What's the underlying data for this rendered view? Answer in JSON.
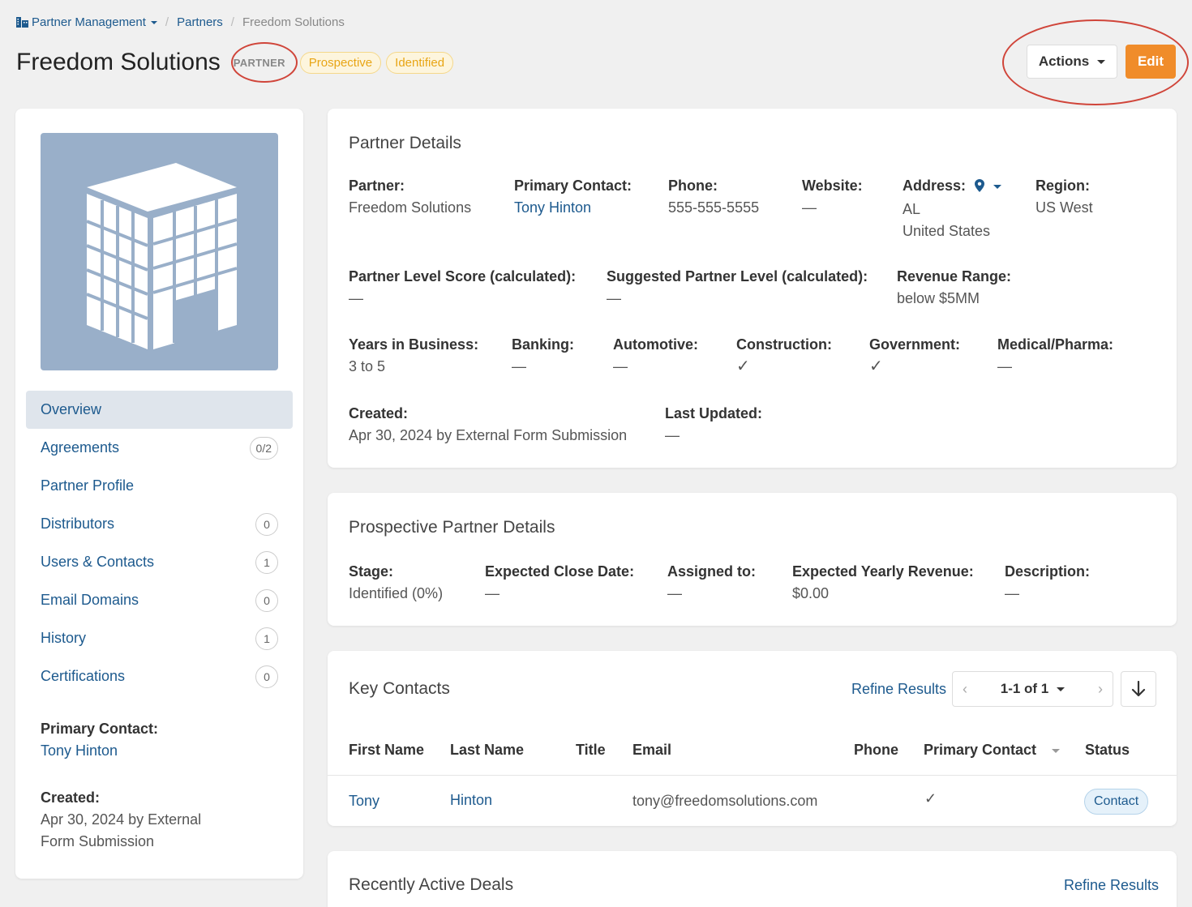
{
  "breadcrumb": {
    "root": "Partner Management",
    "section": "Partners",
    "current": "Freedom Solutions"
  },
  "header": {
    "title": "Freedom Solutions",
    "type_label": "PARTNER",
    "badges": [
      "Prospective",
      "Identified"
    ],
    "actions_label": "Actions",
    "edit_label": "Edit"
  },
  "sidebar": {
    "nav": [
      {
        "label": "Overview",
        "count": null,
        "active": true
      },
      {
        "label": "Agreements",
        "count": "0/2"
      },
      {
        "label": "Partner Profile",
        "count": null
      },
      {
        "label": "Distributors",
        "count": "0"
      },
      {
        "label": "Users & Contacts",
        "count": "1"
      },
      {
        "label": "Email Domains",
        "count": "0"
      },
      {
        "label": "History",
        "count": "1"
      },
      {
        "label": "Certifications",
        "count": "0"
      }
    ],
    "primary_contact_label": "Primary Contact:",
    "primary_contact_value": "Tony Hinton",
    "created_label": "Created:",
    "created_line1": "Apr 30, 2024 by External",
    "created_line2": "Form Submission"
  },
  "partner_details": {
    "title": "Partner Details",
    "partner_label": "Partner:",
    "partner_value": "Freedom Solutions",
    "primary_contact_label": "Primary Contact:",
    "primary_contact_value": "Tony Hinton",
    "phone_label": "Phone:",
    "phone_value": "555-555-5555",
    "website_label": "Website:",
    "website_value": "—",
    "address_label": "Address:",
    "address_line1": "AL",
    "address_line2": "United States",
    "region_label": "Region:",
    "region_value": "US West",
    "score_label": "Partner Level Score (calculated):",
    "score_value": "—",
    "suggested_label": "Suggested Partner Level (calculated):",
    "suggested_value": "—",
    "revenue_label": "Revenue Range:",
    "revenue_value": "below $5MM",
    "years_label": "Years in Business:",
    "years_value": "3 to 5",
    "banking_label": "Banking:",
    "banking_value": "—",
    "automotive_label": "Automotive:",
    "automotive_value": "—",
    "construction_label": "Construction:",
    "construction_value": "✓",
    "government_label": "Government:",
    "government_value": "✓",
    "medical_label": "Medical/Pharma:",
    "medical_value": "—",
    "created_label": "Created:",
    "created_value": "Apr 30, 2024 by External Form Submission",
    "updated_label": "Last Updated:",
    "updated_value": "—"
  },
  "prospective": {
    "title": "Prospective Partner Details",
    "stage_label": "Stage:",
    "stage_value": "Identified (0%)",
    "close_label": "Expected Close Date:",
    "close_value": "—",
    "assigned_label": "Assigned to:",
    "assigned_value": "—",
    "revenue_label": "Expected Yearly Revenue:",
    "revenue_value": "$0.00",
    "description_label": "Description:",
    "description_value": "—"
  },
  "key_contacts": {
    "title": "Key Contacts",
    "refine_label": "Refine Results",
    "pager_text": "1-1 of 1",
    "columns": [
      "First Name",
      "Last Name",
      "Title",
      "Email",
      "Phone",
      "Primary Contact",
      "Status"
    ],
    "rows": [
      {
        "first": "Tony",
        "last": "Hinton",
        "title": "",
        "email": "tony@freedomsolutions.com",
        "phone": "",
        "primary": "✓",
        "status": "Contact"
      }
    ]
  },
  "deals": {
    "title": "Recently Active Deals",
    "refine_label": "Refine Results"
  },
  "colors": {
    "accent": "#f08c2a",
    "link": "#1d5a8e",
    "badge_yellow": "#e8a515",
    "annotation": "#d0453a"
  }
}
